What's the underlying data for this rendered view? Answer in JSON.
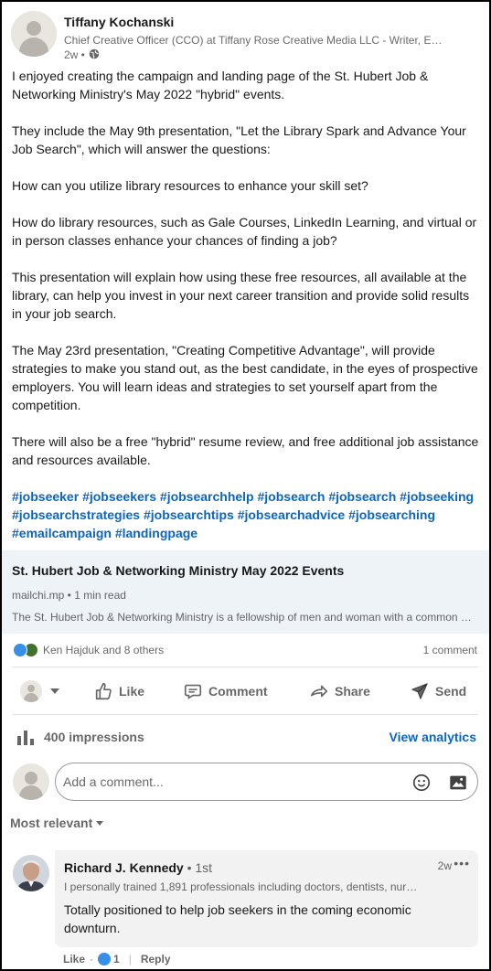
{
  "post": {
    "author_name": "Tiffany Kochanski",
    "author_headline": "Chief Creative Officer (CCO) at Tiffany Rose Creative Media LLC - Writer, Editor, Designer",
    "time": "2w •",
    "paragraphs": [
      "I enjoyed creating the campaign and landing page of the St. Hubert Job & Networking Ministry's May 2022 \"hybrid\" events.",
      "They include the May 9th presentation, \"Let the Library Spark and Advance Your Job Search\", which will answer the questions:",
      "How can you utilize library resources to enhance your skill set?",
      "How do library resources, such as Gale Courses, LinkedIn Learning, and virtual or in person classes enhance your chances of finding a job?",
      "This presentation will explain how using these free resources, all available at the library, can help you invest in your next career transition and provide solid results in your job search.",
      "The May 23rd presentation, \"Creating Competitive Advantage\", will provide strategies to make you stand out, as the best candidate, in the eyes of prospective employers. You will learn ideas and strategies to set yourself apart from the competition.",
      "There will also be a free \"hybrid\" resume review, and free additional job assistance and resources available."
    ],
    "hashtags": [
      "#jobseeker",
      "#jobseekers",
      "#jobsearchhelp",
      "#jobsearch",
      "#jobsearch",
      "#jobseeking",
      "#jobsearchstrategies",
      "#jobsearchtips",
      "#jobsearchadvice",
      "#jobsearching",
      "#emailcampaign",
      "#landingpage"
    ]
  },
  "link_card": {
    "title": "St. Hubert Job & Networking Ministry May 2022 Events",
    "meta": "mailchi.mp • 1 min read",
    "description": "The St. Hubert Job & Networking Ministry is a fellowship of men and woman with a common goal of helping job seekers"
  },
  "social": {
    "reactions_text": "Ken Hajduk and 8 others",
    "comment_count": "1 comment"
  },
  "actions": {
    "like": "Like",
    "comment": "Comment",
    "share": "Share",
    "send": "Send"
  },
  "analytics": {
    "impressions": "400 impressions",
    "view_analytics": "View analytics"
  },
  "comment_box": {
    "placeholder": "Add a comment..."
  },
  "sort": {
    "label": "Most relevant"
  },
  "comment": {
    "name": "Richard J. Kennedy",
    "degree": "• 1st",
    "headline": "I personally trained 1,891 professionals including doctors, dentists, nurses and more",
    "time": "2w",
    "more": "•••",
    "text": "Totally positioned to help job seekers in the coming economic downturn.",
    "like_label": "Like",
    "like_count": "1",
    "reply_label": "Reply"
  },
  "colors": {
    "link_blue": "#0a66c2",
    "like_blue": "#378fe9",
    "card_bg": "#eef3f8"
  }
}
